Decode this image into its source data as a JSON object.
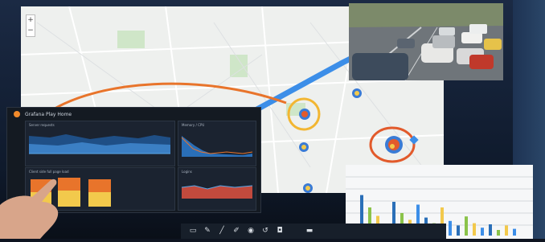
{
  "scene": {
    "map": {
      "zoom_in": "+",
      "zoom_out": "−"
    },
    "dashboard": {
      "title": "Grafana Play Home",
      "panels": [
        {
          "title": "Server requests"
        },
        {
          "title": "Memory / CPU"
        },
        {
          "title": "Client side full page load"
        },
        {
          "title": "Logins"
        }
      ]
    },
    "toolbar": {
      "icons": [
        "eraser-icon",
        "pen-icon",
        "marker-icon",
        "brush-icon",
        "color-icon",
        "undo-icon",
        "camera-icon",
        "note-icon"
      ]
    }
  },
  "colors": {
    "highlight_ring": "#f2b632",
    "annotation_ring": "#e25a2b",
    "route": "#3c8ee8",
    "hotspot": "#f2c94c"
  },
  "whiteboard_bars": [
    0.72,
    0.5,
    0.35,
    0.2,
    0.6,
    0.4,
    0.28,
    0.55,
    0.32,
    0.22,
    0.5,
    0.26,
    0.18,
    0.34,
    0.22,
    0.14,
    0.2,
    0.1,
    0.18,
    0.12
  ]
}
